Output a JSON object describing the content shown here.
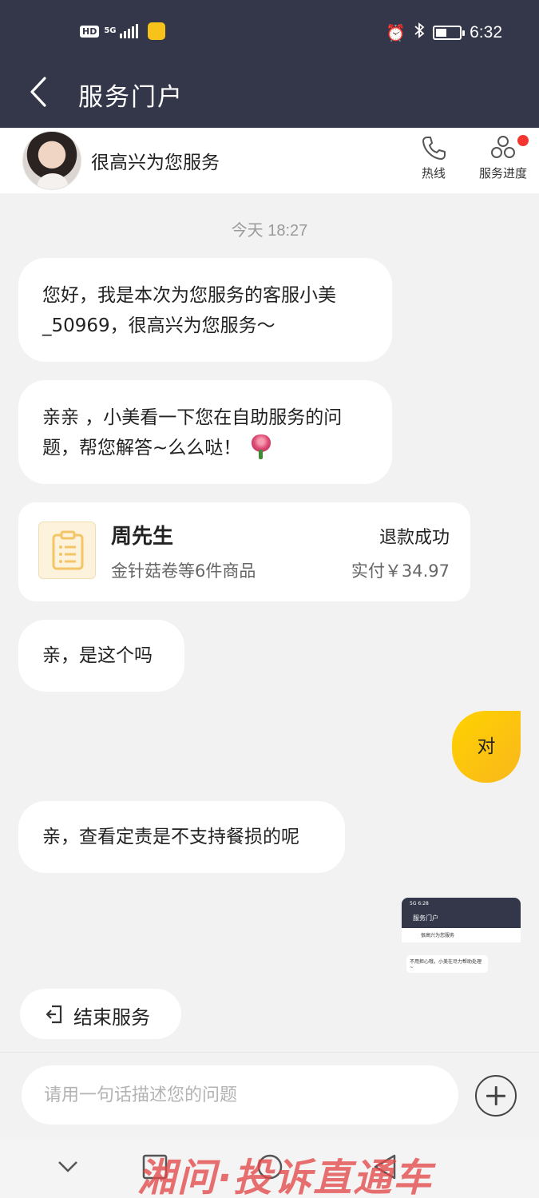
{
  "status_bar": {
    "hd": "HD",
    "network": "5G",
    "time": "6:32",
    "battery_level": 0.45
  },
  "nav": {
    "title": "服务门户"
  },
  "agent": {
    "greeting": "很高兴为您服务",
    "hotline_label": "热线",
    "progress_label": "服务进度"
  },
  "chat": {
    "timestamp": "今天 18:27",
    "msg1": "您好，我是本次为您服务的客服小美_50969，很高兴为您服务～",
    "msg2": "亲亲 ，小美看一下您在自助服务的问题，帮您解答~么么哒！",
    "order": {
      "name": "周先生",
      "status": "退款成功",
      "items": "金针菇卷等6件商品",
      "paid": "实付￥34.97"
    },
    "msg3": "亲，是这个吗",
    "user_reply": "对",
    "msg4": "亲，查看定责是不支持餐损的呢",
    "thumbnail": {
      "time": "5G 6:28",
      "title": "服务门户",
      "greeting": "很高兴为您服务",
      "message": "不用担心哦，小美在尽力帮助处理~"
    }
  },
  "actions": {
    "end_service": "结束服务"
  },
  "input": {
    "placeholder": "请用一句话描述您的问题"
  },
  "watermark": "湘问·投诉直通车",
  "colors": {
    "header_bg": "#34364a",
    "user_bubble": "#ffd200",
    "badge": "#f43530"
  }
}
